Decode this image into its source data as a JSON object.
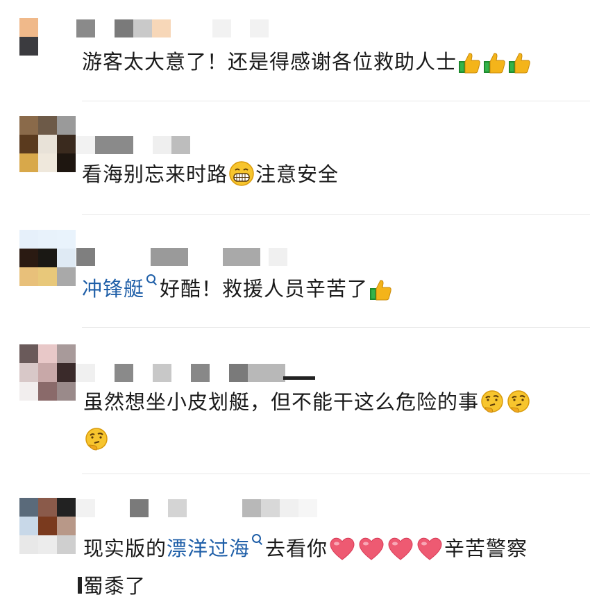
{
  "comments": [
    {
      "text": "游客太大意了！还是得感谢各位救助人士",
      "emoji": [
        "thumbs-up-icon",
        "thumbs-up-icon",
        "thumbs-up-icon"
      ]
    },
    {
      "text_before": "看海别忘来时路",
      "emoji": [
        "grinning-face-icon"
      ],
      "text_after": "注意安全"
    },
    {
      "link_label": "冲锋艇",
      "text_after": "好酷！救援人员辛苦了",
      "emoji": [
        "thumbs-up-icon"
      ]
    },
    {
      "text_before": "虽然想坐小皮划艇，但不能干这么危险的事",
      "emoji": [
        "thinking-face-icon",
        "thinking-face-icon",
        "thinking-face-icon"
      ]
    },
    {
      "text_before": "现实版的",
      "link_label": "漂洋过海",
      "text_middle": "去看你",
      "emoji": [
        "heart-icon",
        "heart-icon",
        "heart-icon",
        "heart-icon"
      ],
      "text_after": "辛苦警察",
      "text_line2": "蜀黍了"
    }
  ],
  "colors": {
    "link": "#1f5fa8",
    "divider": "#e8e8e8"
  }
}
